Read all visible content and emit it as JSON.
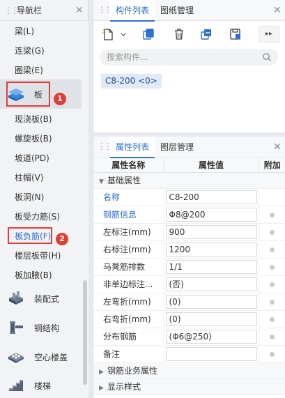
{
  "nav": {
    "title": "导航栏",
    "items": [
      {
        "label": "梁(L)"
      },
      {
        "label": "连梁(G)"
      },
      {
        "label": "圈梁(E)"
      }
    ],
    "selected_label": "板",
    "sub_items": [
      {
        "label": "现浇板(B)"
      },
      {
        "label": "螺旋板(B)"
      },
      {
        "label": "坡道(PD)"
      },
      {
        "label": "柱帽(V)"
      },
      {
        "label": "板洞(N)"
      },
      {
        "label": "板受力筋(S)"
      },
      {
        "label": "板负筋(F)"
      },
      {
        "label": "楼层板带(H)"
      },
      {
        "label": "板加腋(B)"
      }
    ],
    "categories": [
      {
        "label": "装配式",
        "icon": "prefab-icon"
      },
      {
        "label": "钢结构",
        "icon": "steel-structure-icon"
      },
      {
        "label": "空心楼盖",
        "icon": "hollow-floor-icon"
      },
      {
        "label": "楼梯",
        "icon": "stairs-icon"
      }
    ],
    "badges": [
      "1",
      "2"
    ]
  },
  "component_panel": {
    "tabs": [
      "构件列表",
      "图纸管理"
    ],
    "search_placeholder": "搜索构件...",
    "tag": "C8-200 <0>"
  },
  "property_panel": {
    "tabs": [
      "属性列表",
      "图层管理"
    ],
    "headers": [
      "属性名称",
      "属性值",
      "附加"
    ],
    "group_basic": "基础属性",
    "rows": [
      {
        "name": "名称",
        "value": "C8-200",
        "blue": true,
        "addon": false
      },
      {
        "name": "钢筋信息",
        "value": "Φ8@200",
        "blue": true,
        "addon": true
      },
      {
        "name": "左标注(mm)",
        "value": "900",
        "blue": false,
        "addon": true
      },
      {
        "name": "右标注(mm)",
        "value": "1200",
        "blue": false,
        "addon": true
      },
      {
        "name": "马凳筋排数",
        "value": "1/1",
        "blue": false,
        "addon": true
      },
      {
        "name": "非单边标注...",
        "value": "(否)",
        "blue": false,
        "addon": true
      },
      {
        "name": "左弯折(mm)",
        "value": "(0)",
        "blue": false,
        "addon": true
      },
      {
        "name": "右弯折(mm)",
        "value": "(0)",
        "blue": false,
        "addon": true
      },
      {
        "name": "分布钢筋",
        "value": "(Φ6@250)",
        "blue": false,
        "addon": true
      },
      {
        "name": "备注",
        "value": "",
        "blue": false,
        "addon": true
      }
    ],
    "group_rebar": "钢筋业务属性",
    "group_display": "显示样式"
  },
  "colors": {
    "accent": "#2e6fd0",
    "annotation": "#e23d35"
  }
}
